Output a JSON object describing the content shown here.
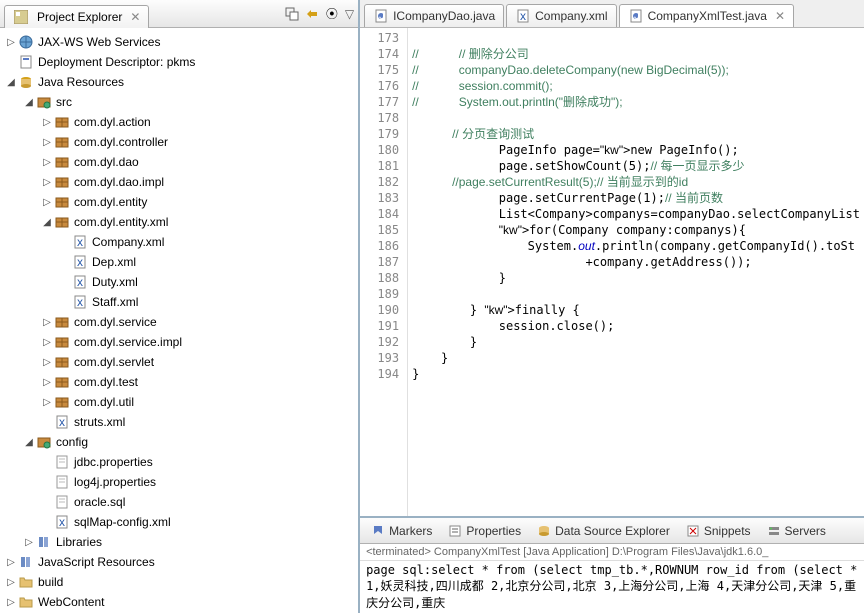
{
  "projectExplorer": {
    "title": "Project Explorer",
    "nodes": [
      {
        "depth": 0,
        "exp": "▷",
        "icon": "globe",
        "label": "JAX-WS Web Services"
      },
      {
        "depth": 0,
        "exp": "",
        "icon": "doc",
        "label": "Deployment Descriptor: pkms"
      },
      {
        "depth": 0,
        "exp": "◢",
        "icon": "jar",
        "label": "Java Resources"
      },
      {
        "depth": 1,
        "exp": "◢",
        "icon": "src",
        "label": "src"
      },
      {
        "depth": 2,
        "exp": "▷",
        "icon": "pkg",
        "label": "com.dyl.action"
      },
      {
        "depth": 2,
        "exp": "▷",
        "icon": "pkg",
        "label": "com.dyl.controller"
      },
      {
        "depth": 2,
        "exp": "▷",
        "icon": "pkg",
        "label": "com.dyl.dao"
      },
      {
        "depth": 2,
        "exp": "▷",
        "icon": "pkg",
        "label": "com.dyl.dao.impl"
      },
      {
        "depth": 2,
        "exp": "▷",
        "icon": "pkg",
        "label": "com.dyl.entity"
      },
      {
        "depth": 2,
        "exp": "◢",
        "icon": "pkg",
        "label": "com.dyl.entity.xml"
      },
      {
        "depth": 3,
        "exp": "",
        "icon": "xml",
        "label": "Company.xml"
      },
      {
        "depth": 3,
        "exp": "",
        "icon": "xml",
        "label": "Dep.xml"
      },
      {
        "depth": 3,
        "exp": "",
        "icon": "xml",
        "label": "Duty.xml"
      },
      {
        "depth": 3,
        "exp": "",
        "icon": "xml",
        "label": "Staff.xml"
      },
      {
        "depth": 2,
        "exp": "▷",
        "icon": "pkg",
        "label": "com.dyl.service"
      },
      {
        "depth": 2,
        "exp": "▷",
        "icon": "pkg",
        "label": "com.dyl.service.impl"
      },
      {
        "depth": 2,
        "exp": "▷",
        "icon": "pkg",
        "label": "com.dyl.servlet"
      },
      {
        "depth": 2,
        "exp": "▷",
        "icon": "pkg",
        "label": "com.dyl.test"
      },
      {
        "depth": 2,
        "exp": "▷",
        "icon": "pkg",
        "label": "com.dyl.util"
      },
      {
        "depth": 2,
        "exp": "",
        "icon": "xml",
        "label": "struts.xml"
      },
      {
        "depth": 1,
        "exp": "◢",
        "icon": "src",
        "label": "config"
      },
      {
        "depth": 2,
        "exp": "",
        "icon": "file",
        "label": "jdbc.properties"
      },
      {
        "depth": 2,
        "exp": "",
        "icon": "file",
        "label": "log4j.properties"
      },
      {
        "depth": 2,
        "exp": "",
        "icon": "file",
        "label": "oracle.sql"
      },
      {
        "depth": 2,
        "exp": "",
        "icon": "xml",
        "label": "sqlMap-config.xml"
      },
      {
        "depth": 1,
        "exp": "▷",
        "icon": "lib",
        "label": "Libraries"
      },
      {
        "depth": 0,
        "exp": "▷",
        "icon": "lib",
        "label": "JavaScript Resources"
      },
      {
        "depth": 0,
        "exp": "▷",
        "icon": "folder",
        "label": "build"
      },
      {
        "depth": 0,
        "exp": "▷",
        "icon": "folder",
        "label": "WebContent"
      }
    ]
  },
  "editorTabs": [
    {
      "icon": "java",
      "label": "ICompanyDao.java",
      "active": false
    },
    {
      "icon": "xml",
      "label": "Company.xml",
      "active": false
    },
    {
      "icon": "java",
      "label": "CompanyXmlTest.java",
      "active": true
    }
  ],
  "gutter": {
    "start": 173,
    "end": 194
  },
  "code": [
    "",
    "//            // 删除分公司",
    "//            companyDao.deleteCompany(new BigDecimal(5));",
    "//            session.commit();",
    "//            System.out.println(\"删除成功\");",
    "",
    "            // 分页查询测试",
    "            PageInfo page=new PageInfo();",
    "            page.setShowCount(5);// 每一页显示多少",
    "            //page.setCurrentResult(5);// 当前显示到的id",
    "            page.setCurrentPage(1);// 当前页数",
    "            List<Company>companys=companyDao.selectCompanyList",
    "            for(Company company:companys){",
    "                System.out.println(company.getCompanyId().toSt",
    "                        +company.getAddress());",
    "            }",
    "",
    "        } finally {",
    "            session.close();",
    "        }",
    "    }",
    "}"
  ],
  "bottomTabs": [
    {
      "icon": "marker",
      "label": "Markers"
    },
    {
      "icon": "prop",
      "label": "Properties"
    },
    {
      "icon": "db",
      "label": "Data Source Explorer"
    },
    {
      "icon": "snip",
      "label": "Snippets"
    },
    {
      "icon": "srv",
      "label": "Servers"
    }
  ],
  "console": {
    "desc": "<terminated> CompanyXmlTest [Java Application] D:\\Program Files\\Java\\jdk1.6.0_",
    "lines": [
      "page sql:select * from (select tmp_tb.*,ROWNUM row_id from (select *",
      "1,妖灵科技,四川成都",
      "2,北京分公司,北京",
      "3,上海分公司,上海",
      "4,天津分公司,天津",
      "5,重庆分公司,重庆"
    ]
  }
}
